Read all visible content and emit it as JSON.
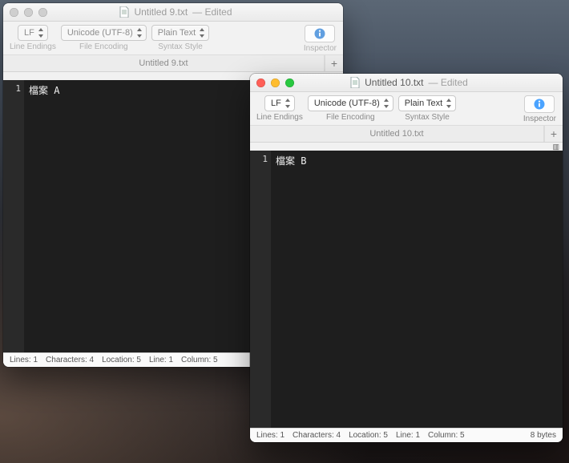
{
  "windows": {
    "back": {
      "title": "Untitled 9.txt",
      "edited": "— Edited",
      "toolbar": {
        "line_endings": {
          "value": "LF",
          "label": "Line Endings"
        },
        "file_encoding": {
          "value": "Unicode (UTF-8)",
          "label": "File Encoding"
        },
        "syntax_style": {
          "value": "Plain Text",
          "label": "Syntax Style"
        },
        "inspector_label": "Inspector"
      },
      "tab": "Untitled 9.txt",
      "plus": "+",
      "editor": {
        "line_no": "1",
        "content": "檔案 A"
      },
      "status": {
        "lines": "Lines: 1",
        "chars": "Characters: 4",
        "location": "Location: 5",
        "line": "Line: 1",
        "column": "Column: 5"
      }
    },
    "front": {
      "title": "Untitled 10.txt",
      "edited": "— Edited",
      "toolbar": {
        "line_endings": {
          "value": "LF",
          "label": "Line Endings"
        },
        "file_encoding": {
          "value": "Unicode (UTF-8)",
          "label": "File Encoding"
        },
        "syntax_style": {
          "value": "Plain Text",
          "label": "Syntax Style"
        },
        "inspector_label": "Inspector"
      },
      "tab": "Untitled 10.txt",
      "plus": "+",
      "editor": {
        "line_no": "1",
        "content": "檔案 B"
      },
      "status": {
        "lines": "Lines: 1",
        "chars": "Characters: 4",
        "location": "Location: 5",
        "line": "Line: 1",
        "column": "Column: 5",
        "bytes": "8 bytes"
      }
    }
  }
}
